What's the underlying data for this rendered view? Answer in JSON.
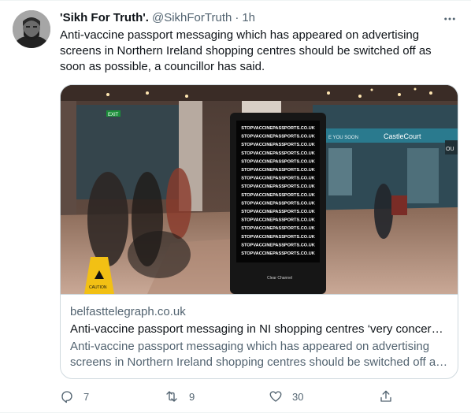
{
  "tweet": {
    "display_name": "'Sikh For Truth'.",
    "handle": "@SikhForTruth",
    "separator": "·",
    "time": "1h",
    "text": "Anti-vaccine passport messaging which has appeared on advertising screens in Northern Ireland shopping centres should be switched off as soon as possible, a councillor has said."
  },
  "card": {
    "domain": "belfasttelegraph.co.uk",
    "title": "Anti-vaccine passport messaging in NI shopping centres ‘very concern…",
    "description": "Anti-vaccine passport messaging which has appeared on advertising screens in Northern Ireland shopping centres should be switched off as soon as possible, a councillor has said.",
    "image": {
      "screen_lines": [
        "STOPVACCINEPASSPORTS.CO.UK",
        "STOPVACCINEPASSPORTS.CO.UK",
        "STOPVACCINEPASSPORTS.CO.UK",
        "STOPVACCINEPASSPORTS.CO.UK",
        "STOPVACCINEPASSPORTS.CO.UK",
        "STOPVACCINEPASSPORTS.CO.UK",
        "STOPVACCINEPASSPORTS.CO.UK",
        "STOPVACCINEPASSPORTS.CO.UK",
        "STOPVACCINEPASSPORTS.CO.UK",
        "STOPVACCINEPASSPORTS.CO.UK",
        "STOPVACCINEPASSPORTS.CO.UK",
        "STOPVACCINEPASSPORTS.CO.UK",
        "STOPVACCINEPASSPORTS.CO.UK",
        "STOPVACCINEPASSPORTS.CO.UK",
        "STOPVACCINEPASSPORTS.CO.UK",
        "STOPVACCINEPASSPORTS.CO.UK"
      ],
      "screen_brand": "Clear Channel",
      "store_sign": "CastleCourt",
      "sign_you_soon": "E YOU SOON",
      "sign_ou": "OU",
      "exit_sign": "EXIT",
      "caution_label": "CAUTION"
    }
  },
  "actions": {
    "reply_count": "7",
    "retweet_count": "9",
    "like_count": "30"
  },
  "colors": {
    "text_primary": "#0f1419",
    "text_secondary": "#536471",
    "border": "#cfd9de"
  },
  "icons": {
    "more": "more-horizontal-icon",
    "reply": "reply-icon",
    "retweet": "retweet-icon",
    "like": "heart-icon",
    "share": "share-icon"
  }
}
